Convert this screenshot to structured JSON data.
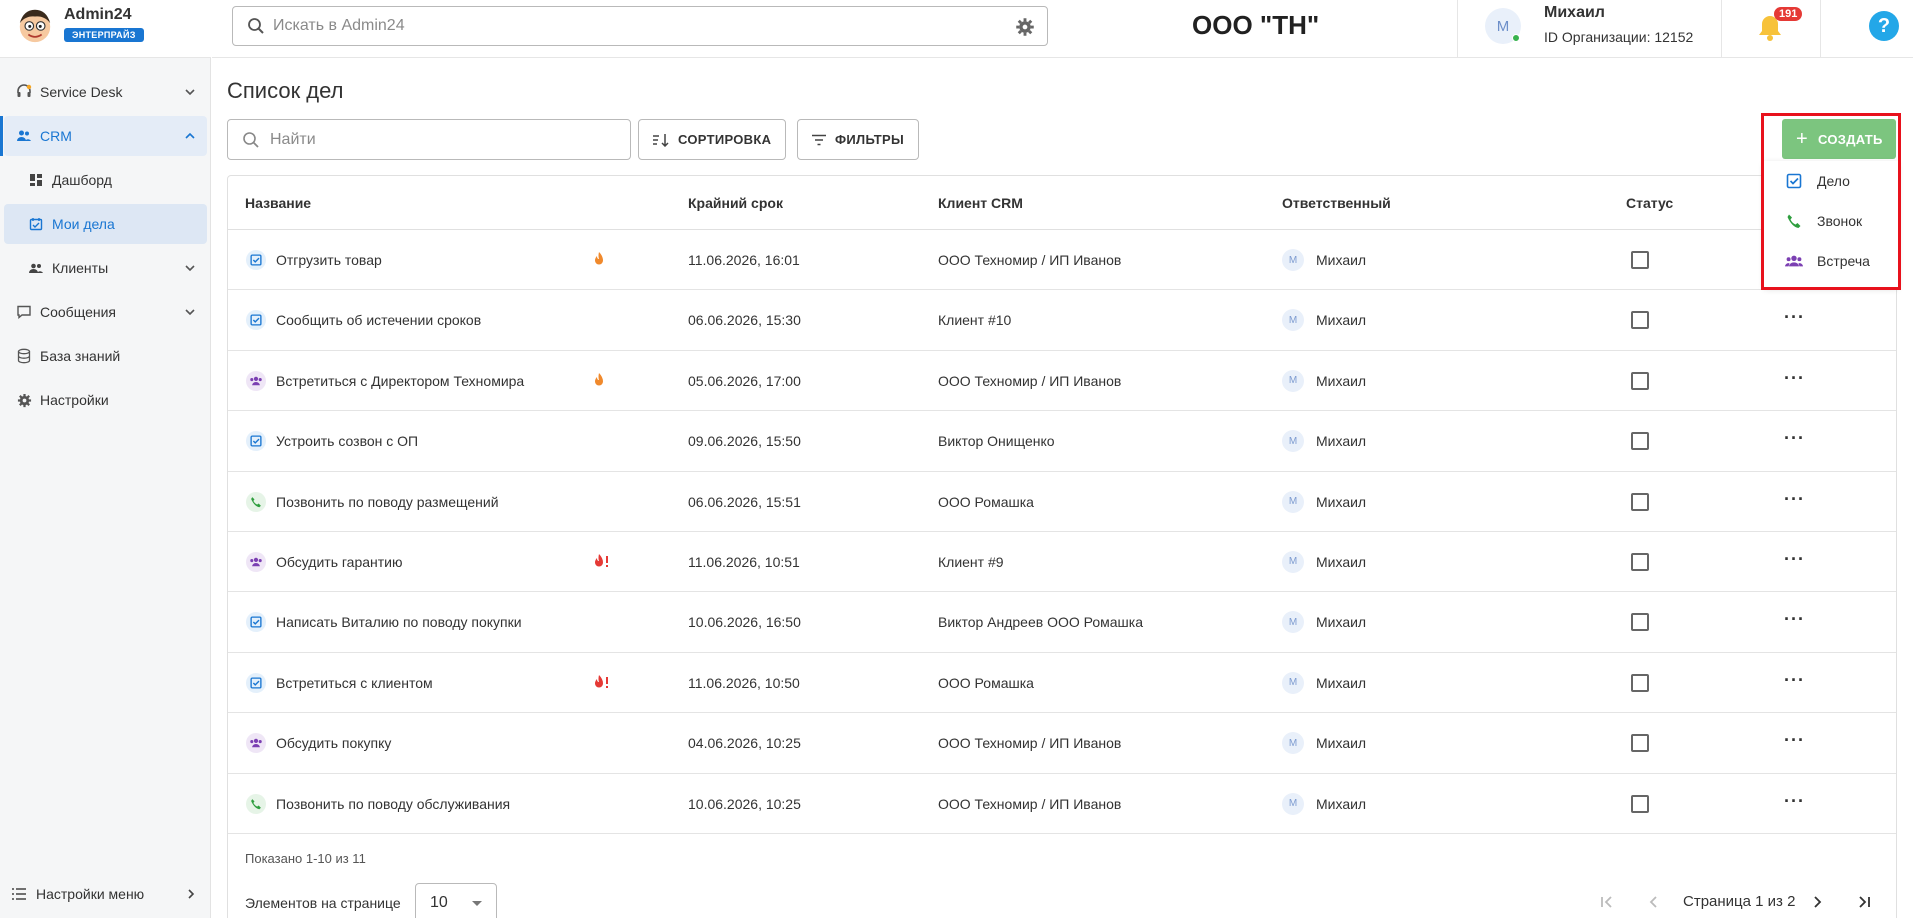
{
  "brand": {
    "name": "Admin24",
    "badge": "ЭНТЕРПРАЙЗ"
  },
  "sidebar": {
    "items": [
      {
        "label": "Service Desk",
        "icon": "headset-icon"
      },
      {
        "label": "CRM",
        "icon": "users-icon"
      },
      {
        "label": "Дашборд",
        "icon": "dashboard-icon"
      },
      {
        "label": "Мои дела",
        "icon": "calendar-check-icon"
      },
      {
        "label": "Клиенты",
        "icon": "clients-icon"
      },
      {
        "label": "Сообщения",
        "icon": "message-icon"
      },
      {
        "label": "База знаний",
        "icon": "database-icon"
      },
      {
        "label": "Настройки",
        "icon": "gear-icon"
      }
    ],
    "footer": "Настройки меню"
  },
  "topbar": {
    "search_placeholder": "Искать в Admin24",
    "org_title": "ООО \"ТН\"",
    "avatar_letter": "М",
    "user_name": "Михаил",
    "org_id": "ID Организации: 12152",
    "notifications": "191",
    "help": "?"
  },
  "page": {
    "title": "Список дел",
    "find_placeholder": "Найти",
    "sort_label": "СОРТИРОВКА",
    "filter_label": "ФИЛЬТРЫ",
    "create_label": "СОЗДАТЬ",
    "create_menu": [
      "Дело",
      "Звонок",
      "Встреча"
    ]
  },
  "table": {
    "headers": [
      "Название",
      "Крайний срок",
      "Клиент CRM",
      "Ответственный",
      "Статус"
    ],
    "rows": [
      {
        "type": "task",
        "name": "Отгрузить товар",
        "fire": "fire",
        "deadline": "11.06.2026, 16:01",
        "client": "ООО Техномир / ИП Иванов",
        "resp": "Михаил",
        "resp_initial": "М"
      },
      {
        "type": "task",
        "name": "Сообщить об истечении сроков",
        "fire": "",
        "deadline": "06.06.2026, 15:30",
        "client": "Клиент #10",
        "resp": "Михаил",
        "resp_initial": "М"
      },
      {
        "type": "meet",
        "name": "Встретиться с Директором Техномира",
        "fire": "fire",
        "deadline": "05.06.2026, 17:00",
        "client": "ООО Техномир / ИП Иванов",
        "resp": "Михаил",
        "resp_initial": "М"
      },
      {
        "type": "task",
        "name": "Устроить созвон с ОП",
        "fire": "",
        "deadline": "09.06.2026, 15:50",
        "client": "Виктор Онищенко",
        "resp": "Михаил",
        "resp_initial": "М"
      },
      {
        "type": "call",
        "name": "Позвонить по поводу размещений",
        "fire": "",
        "deadline": "06.06.2026, 15:51",
        "client": "ООО Ромашка",
        "resp": "Михаил",
        "resp_initial": "М"
      },
      {
        "type": "meet",
        "name": "Обсудить гарантию",
        "fire": "urgent",
        "deadline": "11.06.2026, 10:51",
        "client": "Клиент #9",
        "resp": "Михаил",
        "resp_initial": "М"
      },
      {
        "type": "task",
        "name": "Написать Виталию по поводу покупки",
        "fire": "",
        "deadline": "10.06.2026, 16:50",
        "client": "Виктор Андреев ООО Ромашка",
        "resp": "Михаил",
        "resp_initial": "М"
      },
      {
        "type": "task",
        "name": "Встретиться с клиентом",
        "fire": "urgent",
        "deadline": "11.06.2026, 10:50",
        "client": "ООО Ромашка",
        "resp": "Михаил",
        "resp_initial": "М"
      },
      {
        "type": "meet",
        "name": "Обсудить покупку",
        "fire": "",
        "deadline": "04.06.2026, 10:25",
        "client": "ООО Техномир / ИП Иванов",
        "resp": "Михаил",
        "resp_initial": "М"
      },
      {
        "type": "call",
        "name": "Позвонить по поводу обслуживания",
        "fire": "",
        "deadline": "10.06.2026, 10:25",
        "client": "ООО Техномир / ИП Иванов",
        "resp": "Михаил",
        "resp_initial": "М"
      }
    ],
    "shown": "Показано 1-10 из 11",
    "per_page_label": "Элементов на странице",
    "per_page_value": "10",
    "page_label": "Страница 1 из 2"
  },
  "colors": {
    "accent": "#1976d2",
    "create": "#7cc57f",
    "highlight": "#e8111c",
    "badge": "#e53935"
  }
}
